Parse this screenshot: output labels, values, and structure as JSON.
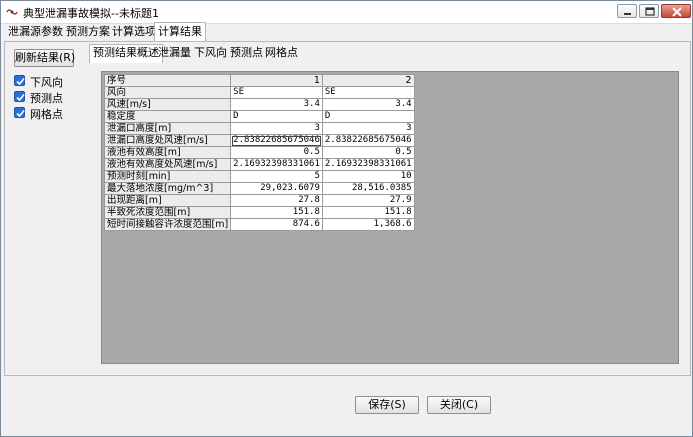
{
  "window": {
    "title": "典型泄漏事故模拟--未标题1"
  },
  "main_tabs": [
    "泄漏源参数",
    "预测方案",
    "计算选项",
    "计算结果"
  ],
  "active_main_tab": 3,
  "left_panel": {
    "refresh_label": "刷新结果(R)",
    "checkboxes": [
      {
        "label": "下风向",
        "checked": true
      },
      {
        "label": "预测点",
        "checked": true
      },
      {
        "label": "网格点",
        "checked": true
      }
    ]
  },
  "sub_tabs": [
    "预测结果概述",
    "泄漏量",
    "下风向",
    "预测点",
    "网格点"
  ],
  "active_sub_tab": 0,
  "table": {
    "headers": [
      "序号",
      "1",
      "2"
    ],
    "rows": [
      [
        "风向",
        "SE",
        "SE"
      ],
      [
        "风速[m/s]",
        "3.4",
        "3.4"
      ],
      [
        "稳定度",
        "D",
        "D"
      ],
      [
        "泄漏口高度[m]",
        "3",
        "3"
      ],
      [
        "泄漏口高度处风速[m/s]",
        "2.83822685675046",
        "2.83822685675046"
      ],
      [
        "液池有效高度[m]",
        "0.5",
        "0.5"
      ],
      [
        "液池有效高度处风速[m/s]",
        "2.16932398331061",
        "2.16932398331061"
      ],
      [
        "预测时刻[min]",
        "5",
        "10"
      ],
      [
        "最大落地浓度[mg/m^3]",
        "29,023.6079",
        "28,516.0385"
      ],
      [
        "出现距离[m]",
        "27.8",
        "27.9"
      ],
      [
        "半致死浓度范围[m]",
        "151.8",
        "151.8"
      ],
      [
        "短时间接触容许浓度范围[m]",
        "874.6",
        "1,368.6"
      ]
    ],
    "left_aligned_rows": [
      0,
      2
    ]
  },
  "footer": {
    "save_label": "保存(S)",
    "close_label": "关闭(C)"
  },
  "colors": {
    "checkbox": "#2b6fd6",
    "grid_background": "#a9a9a9"
  }
}
